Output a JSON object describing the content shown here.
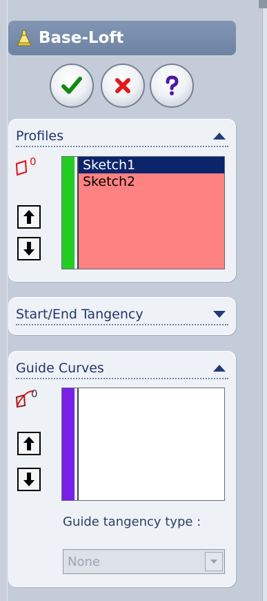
{
  "feature": {
    "title": "Base-Loft"
  },
  "actions": {
    "ok": "ok",
    "cancel": "cancel",
    "help": "help"
  },
  "profiles": {
    "title": "Profiles",
    "count_label": "0",
    "items": [
      "Sketch1",
      "Sketch2"
    ],
    "selected_index": 0,
    "strip_color": "#22cc22",
    "list_color": "#ff8282"
  },
  "tangency": {
    "title": "Start/End Tangency"
  },
  "guide_curves": {
    "title": "Guide Curves",
    "count_label": "0",
    "items": [],
    "strip_color": "#7a1fe6",
    "guide_tangency_label": "Guide tangency type :",
    "guide_tangency_value": "None"
  },
  "colors": {
    "panel_background": "#c4ccd9",
    "title_bar": "#7489a9",
    "selection": "#0c246a",
    "ok_icon": "#138a13",
    "cancel_icon": "#e11919",
    "help_icon": "#4b1aa8"
  },
  "icons": {
    "title": "loft-feature-icon",
    "ok": "checkmark-icon",
    "cancel": "x-icon",
    "help": "question-icon",
    "profiles_selection": "profile-selection-icon",
    "guide_selection": "guide-curve-selection-icon",
    "move_up": "move-up-icon",
    "move_down": "move-down-icon"
  }
}
